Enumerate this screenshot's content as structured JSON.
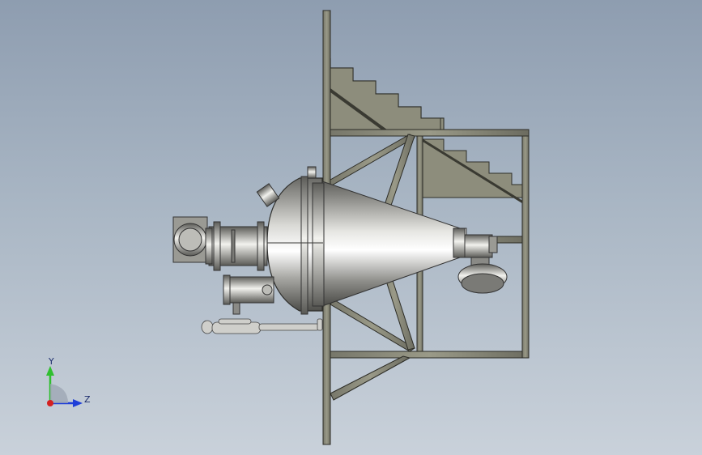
{
  "viewport": {
    "background_top": "#8e9db0",
    "background_bottom": "#c9d1da"
  },
  "model": {
    "steel_color": "#8a8a78",
    "vessel_highlight": "#ffffff",
    "vessel_shadow": "#4a4a4a"
  },
  "triad": {
    "y_label": "Y",
    "z_label": "Z",
    "y_color": "#2fbf2f",
    "z_color": "#1f3fd8",
    "x_color": "#d42020"
  }
}
